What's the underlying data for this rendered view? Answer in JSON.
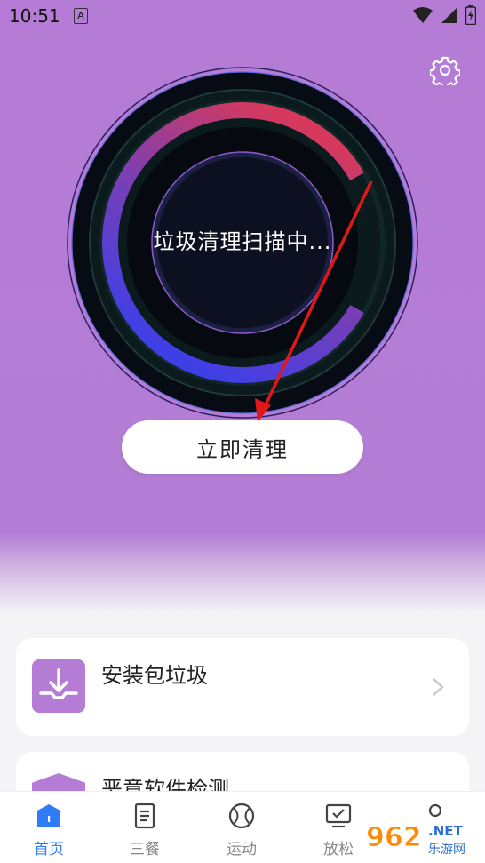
{
  "status_bar": {
    "time": "10:51",
    "indicator": "A"
  },
  "hero": {
    "scan_status": "垃圾清理扫描中...",
    "clean_button": "立即清理"
  },
  "cards": [
    {
      "title": "安装包垃圾",
      "icon": "download-tray-icon"
    },
    {
      "title": "恶意软件检测",
      "icon": "shield-icon"
    }
  ],
  "tabs": [
    {
      "label": "首页",
      "icon": "home-icon",
      "active": true
    },
    {
      "label": "三餐",
      "icon": "document-icon"
    },
    {
      "label": "运动",
      "icon": "ball-icon"
    },
    {
      "label": "放松",
      "icon": "monitor-check-icon"
    },
    {
      "label": "",
      "icon": "profile-icon"
    }
  ],
  "watermark": {
    "text": "962",
    "sub": "乐游网",
    "suffix": ".NET"
  },
  "colors": {
    "accent": "#b57cd6",
    "tab_active": "#2f7cf6"
  }
}
